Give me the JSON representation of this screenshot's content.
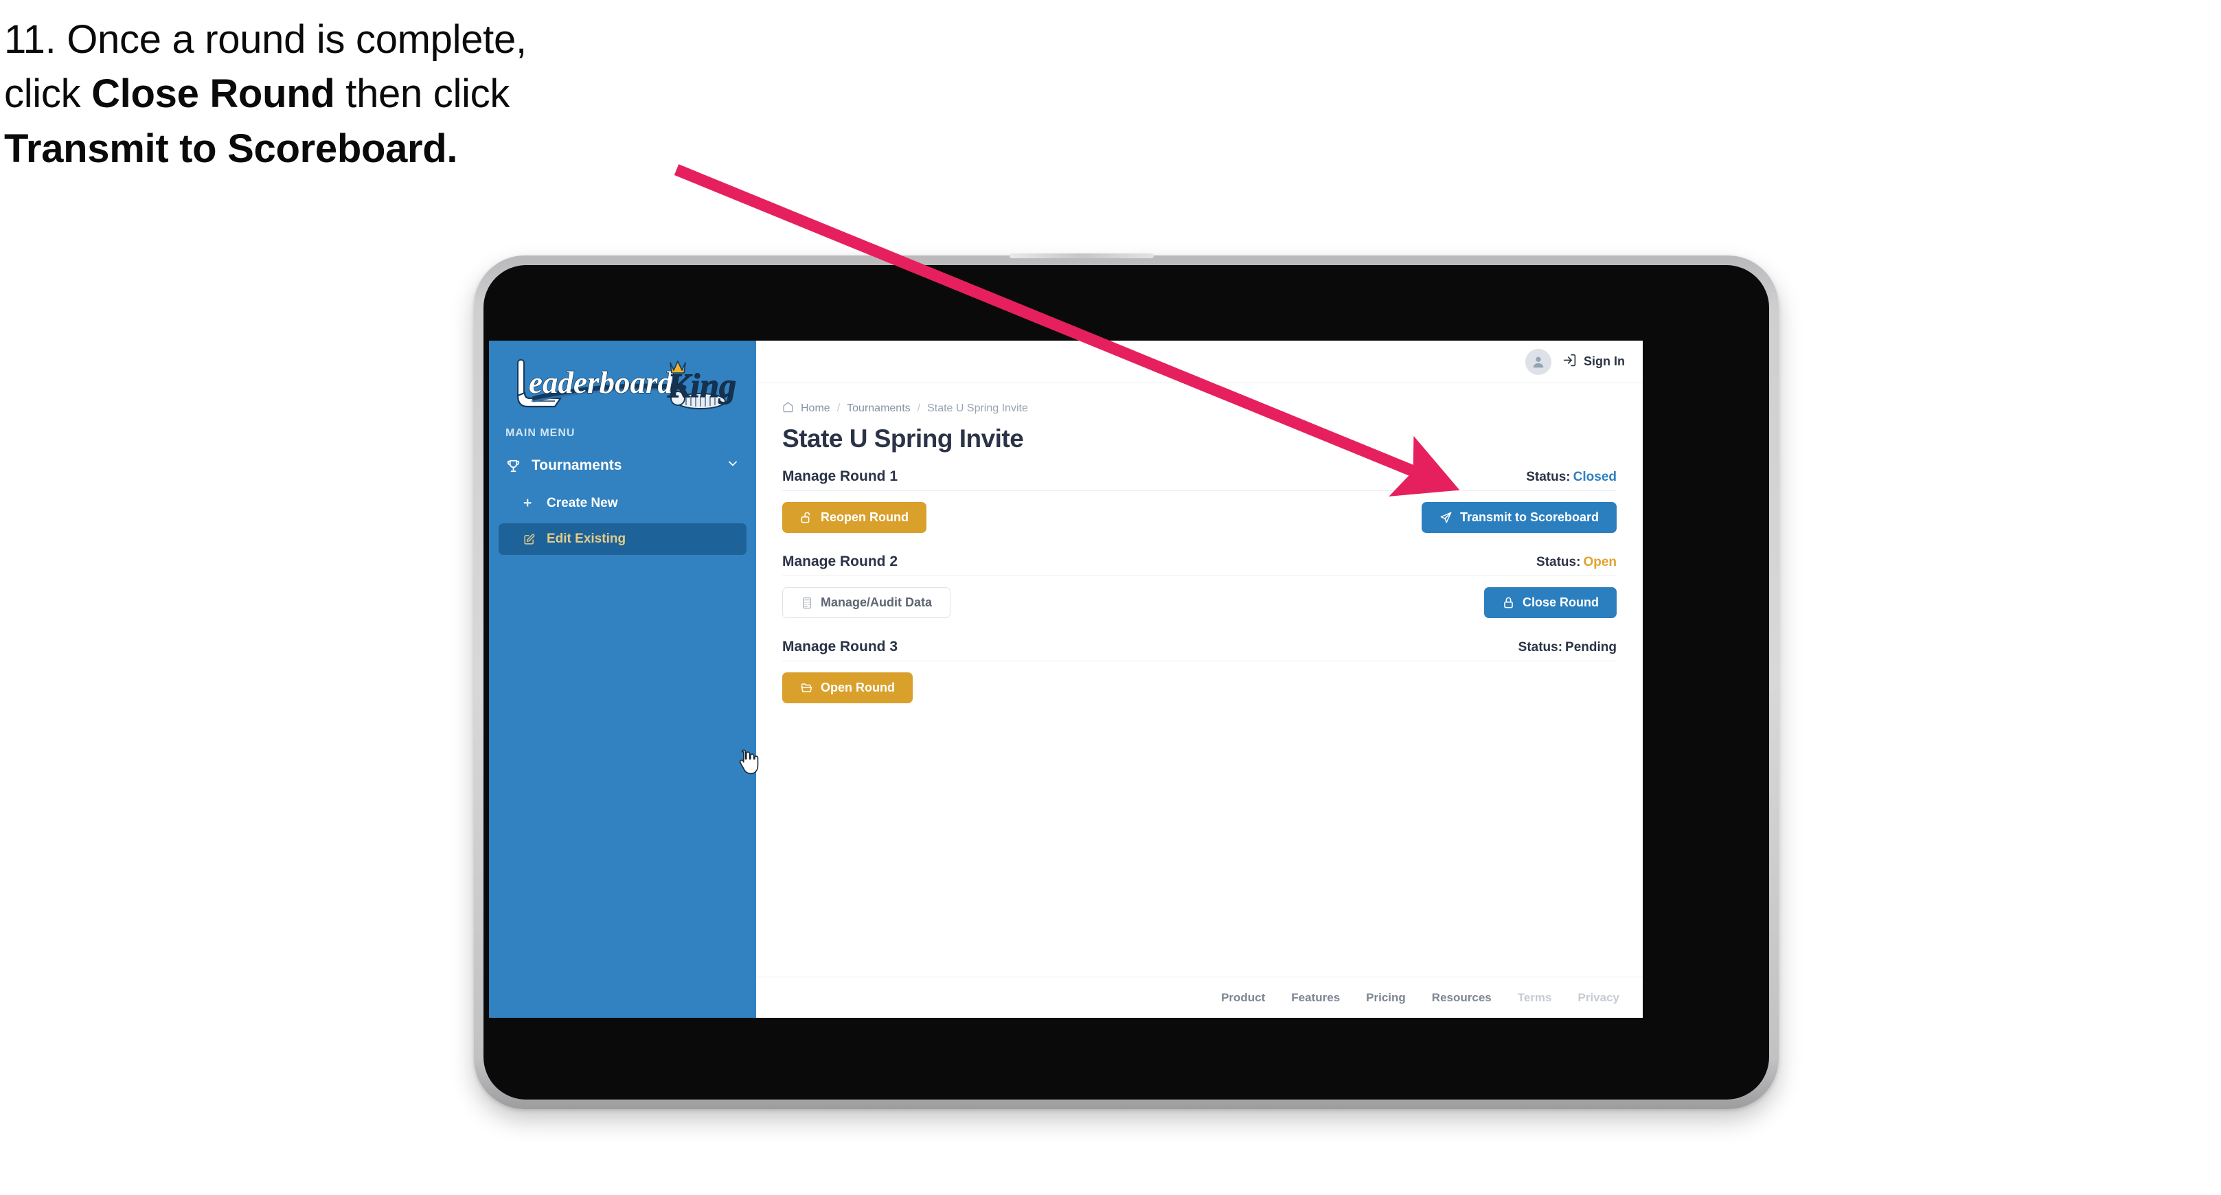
{
  "instruction": {
    "step_number": "11.",
    "line1_pre": "11. Once a round is complete,",
    "line2_pre": "click ",
    "line2_bold": "Close Round",
    "line2_post": " then click",
    "line3_bold": "Transmit to Scoreboard."
  },
  "annotation": {
    "arrow_color": "#e6205e",
    "points_to": "Transmit to Scoreboard"
  },
  "app": {
    "sidebar": {
      "logo_text_primary": "Leaderboard",
      "logo_text_secondary": "King",
      "menu_label": "MAIN MENU",
      "background_color": "#3281c0",
      "items": [
        {
          "label": "Tournaments",
          "icon": "trophy-icon",
          "chevron": "chevron-down-icon",
          "active": false
        },
        {
          "label": "Create New",
          "icon": "plus-icon",
          "active": false
        },
        {
          "label": "Edit Existing",
          "icon": "edit-pencil-icon",
          "active": true
        }
      ]
    },
    "topbar": {
      "avatar_icon": "user-avatar-icon",
      "signin_icon": "sign-in-arrow-icon",
      "signin_label": "Sign In"
    },
    "breadcrumb": {
      "home_icon": "home-icon",
      "items": [
        "Home",
        "Tournaments",
        "State U Spring Invite"
      ],
      "separator": "/"
    },
    "page_title": "State U Spring Invite",
    "rounds": [
      {
        "name": "Manage Round 1",
        "status_label": "Status:",
        "status_value": "Closed",
        "status_class": "status-closed",
        "left_button": {
          "label": "Reopen Round",
          "icon": "unlock-icon",
          "style": "btn-gold"
        },
        "right_button": {
          "label": "Transmit to Scoreboard",
          "icon": "paper-plane-icon",
          "style": "btn-blue"
        }
      },
      {
        "name": "Manage Round 2",
        "status_label": "Status:",
        "status_value": "Open",
        "status_class": "status-open",
        "left_button": {
          "label": "Manage/Audit Data",
          "icon": "calculator-icon",
          "style": "btn-ghost"
        },
        "right_button": {
          "label": "Close Round",
          "icon": "lock-icon",
          "style": "btn-blue"
        }
      },
      {
        "name": "Manage Round 3",
        "status_label": "Status:",
        "status_value": "Pending",
        "status_class": "status-pending",
        "left_button": {
          "label": "Open Round",
          "icon": "folder-open-icon",
          "style": "btn-gold"
        },
        "right_button": null
      }
    ],
    "footer": {
      "links": [
        {
          "label": "Product",
          "muted": false
        },
        {
          "label": "Features",
          "muted": false
        },
        {
          "label": "Pricing",
          "muted": false
        },
        {
          "label": "Resources",
          "muted": false
        },
        {
          "label": "Terms",
          "muted": true
        },
        {
          "label": "Privacy",
          "muted": true
        }
      ]
    }
  },
  "colors": {
    "sidebar_blue": "#3281c0",
    "sidebar_active": "#1d6399",
    "gold": "#d9a02c",
    "blue_button": "#2b7fbf",
    "arrow_pink": "#e6205e",
    "heading_navy": "#2b3347"
  }
}
